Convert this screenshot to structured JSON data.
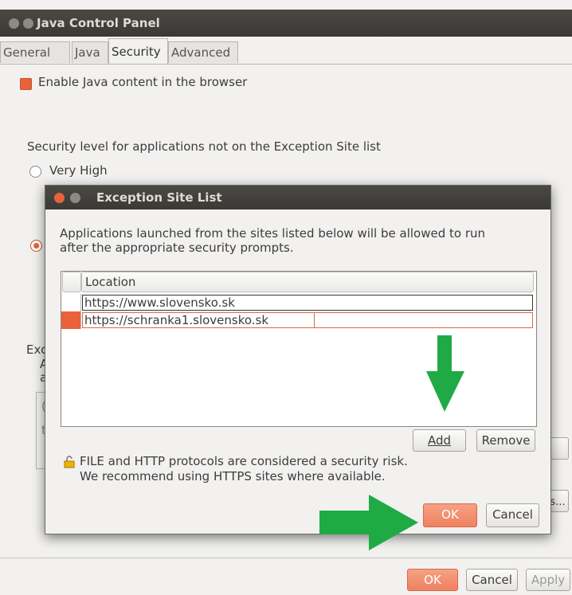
{
  "window": {
    "title": "Java Control Panel",
    "tabs": [
      "General",
      "Java",
      "Security",
      "Advanced"
    ],
    "active_tab": "Security"
  },
  "security": {
    "enable_java_label": "Enable Java content in the browser",
    "level_heading": "Security level for applications not on the Exception Site list",
    "very_high_label": "Very High",
    "partial_exc": "Exc",
    "partial_a": "A",
    "partial_a2": "a",
    "partial_c": "(",
    "partial_t": "t",
    "partial_s": "s..."
  },
  "footer": {
    "ok_label": "OK",
    "cancel_label": "Cancel",
    "apply_label": "Apply"
  },
  "dialog": {
    "title": "Exception Site List",
    "description_line1": "Applications launched from the sites listed below will be allowed to run",
    "description_line2": "after the appropriate security prompts.",
    "column_location": "Location",
    "rows": [
      {
        "location": "https://www.slovensko.sk",
        "selected": false
      },
      {
        "location": "https://schranka1.slovensko.sk",
        "selected": true
      }
    ],
    "add_label": "Add",
    "remove_label": "Remove",
    "warning_line1": "FILE and HTTP protocols are considered a security risk.",
    "warning_line2": "We recommend using HTTPS sites where available.",
    "ok_label": "OK",
    "cancel_label": "Cancel"
  },
  "colors": {
    "accent": "#e9623c",
    "annotation_arrow": "#1faa45",
    "titlebar": "#3c3b37"
  },
  "icons": [
    "close-icon",
    "minimize-icon",
    "lock-icon",
    "annotation-arrow-down-icon",
    "annotation-arrow-right-icon"
  ]
}
